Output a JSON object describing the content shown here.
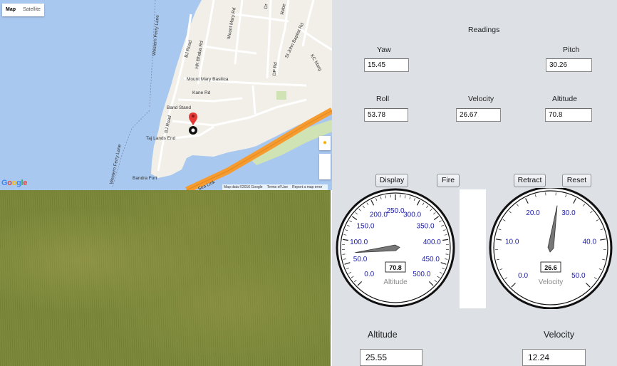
{
  "map": {
    "type_control": {
      "map": "Map",
      "satellite": "Satellite"
    },
    "labels": {
      "western_ferry_lane_top": "Western Ferry Lane",
      "western_ferry_lane_bottom": "Western Ferry Lane",
      "bj_road_top": "BJ Road",
      "hk_bhaba_rd": "HK Bhaba Rd",
      "mount_mary_rd": "Mount Mary Rd",
      "dr": "Dr",
      "rebe": "Rebe",
      "st_john_baptist_rd": "St John Baptist Rd",
      "dp_rd": "DP Rd",
      "kc_marg": "KC Marg",
      "mount_mary_basilica": "Mount Mary Basilica",
      "kane_rd": "Kane Rd",
      "band_stand": "Band Stand",
      "bj_road_bottom": "BJ Road",
      "taj_lands_end": "Taj Lands End",
      "bandra_fort": "Bandra Fort",
      "sea_link": "Sea Link"
    },
    "footer": {
      "map_data": "Map data ©2016 Google",
      "terms": "Terms of Use",
      "report": "Report a map error"
    },
    "logo": "Google",
    "icons": {
      "pegman": "pegman-icon",
      "marker": "map-marker-icon"
    },
    "colors": {
      "water": "#a8c8f0",
      "land": "#f2efe9",
      "highway": "#f59b2f"
    }
  },
  "panel": {
    "title": "Readings",
    "yaw": {
      "label": "Yaw",
      "value": "15.45"
    },
    "pitch": {
      "label": "Pitch",
      "value": "30.26"
    },
    "roll": {
      "label": "Roll",
      "value": "53.78"
    },
    "velocity": {
      "label": "Velocity",
      "value": "26.67"
    },
    "altitude": {
      "label": "Altitude",
      "value": "70.8"
    },
    "buttons": {
      "display": "Display",
      "fire": "Fire",
      "retract": "Retract",
      "reset": "Reset"
    },
    "altitude_gauge": {
      "caption": "Altitude",
      "readout": "70.8",
      "value": 70.8,
      "min": 0,
      "max": 500,
      "ticks": [
        "0.0",
        "50.0",
        "100.0",
        "150.0",
        "200.0",
        "250.0",
        "300.0",
        "350.0",
        "400.0",
        "450.0",
        "500.0"
      ]
    },
    "velocity_gauge": {
      "caption": "Velocity",
      "readout": "26.6",
      "value": 26.6,
      "min": 0,
      "max": 50,
      "ticks": [
        "0.0",
        "10.0",
        "20.0",
        "30.0",
        "40.0",
        "50.0"
      ]
    },
    "bottom": {
      "altitude_label": "Altitude",
      "altitude_value": "25.55",
      "velocity_label": "Velocity",
      "velocity_value": "12.24"
    },
    "colors": {
      "panel_bg": "#dde1e6",
      "tick_label": "#1a1aa8"
    }
  }
}
